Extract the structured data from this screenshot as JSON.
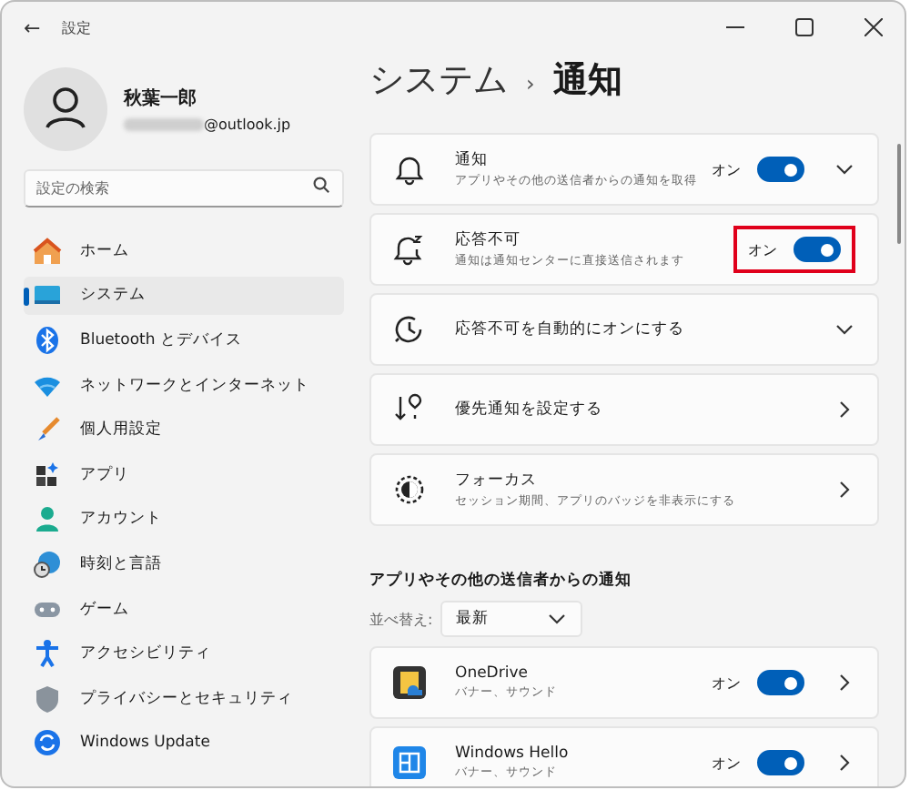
{
  "window": {
    "title": "設定",
    "back": "←"
  },
  "profile": {
    "name": "秋葉一郎",
    "email": "@outlook.jp"
  },
  "search": {
    "placeholder": "設定の検索"
  },
  "sidebar": {
    "items": [
      {
        "label": "ホーム",
        "selected": false
      },
      {
        "label": "システム",
        "selected": true
      },
      {
        "label": "Bluetooth とデバイス",
        "selected": false
      },
      {
        "label": "ネットワークとインターネット",
        "selected": false
      },
      {
        "label": "個人用設定",
        "selected": false
      },
      {
        "label": "アプリ",
        "selected": false
      },
      {
        "label": "アカウント",
        "selected": false
      },
      {
        "label": "時刻と言語",
        "selected": false
      },
      {
        "label": "ゲーム",
        "selected": false
      },
      {
        "label": "アクセシビリティ",
        "selected": false
      },
      {
        "label": "プライバシーとセキュリティ",
        "selected": false
      },
      {
        "label": "Windows Update",
        "selected": false
      }
    ]
  },
  "breadcrumb": {
    "parent": "システム",
    "separator": "›",
    "current": "通知"
  },
  "settings": [
    {
      "title": "通知",
      "subtitle": "アプリやその他の送信者からの通知を取得",
      "toggle": {
        "label": "オン",
        "on": true
      },
      "kind": "expander",
      "highlighted": false
    },
    {
      "title": "応答不可",
      "subtitle": "通知は通知センターに直接送信されます",
      "toggle": {
        "label": "オン",
        "on": true
      },
      "kind": "plain",
      "highlighted": true
    },
    {
      "title": "応答不可を自動的にオンにする",
      "kind": "expander",
      "highlighted": false
    },
    {
      "title": "優先通知を設定する",
      "kind": "link",
      "highlighted": false
    },
    {
      "title": "フォーカス",
      "subtitle": "セッション期間、アプリのバッジを非表示にする",
      "kind": "link",
      "highlighted": false
    }
  ],
  "apps_section": {
    "title": "アプリやその他の送信者からの通知",
    "sort_label": "並べ替え:",
    "sort_value": "最新",
    "apps": [
      {
        "name": "OneDrive",
        "subtitle": "バナー、サウンド",
        "toggle": {
          "label": "オン",
          "on": true
        }
      },
      {
        "name": "Windows Hello",
        "subtitle": "バナー、サウンド",
        "toggle": {
          "label": "オン",
          "on": true
        }
      }
    ]
  }
}
